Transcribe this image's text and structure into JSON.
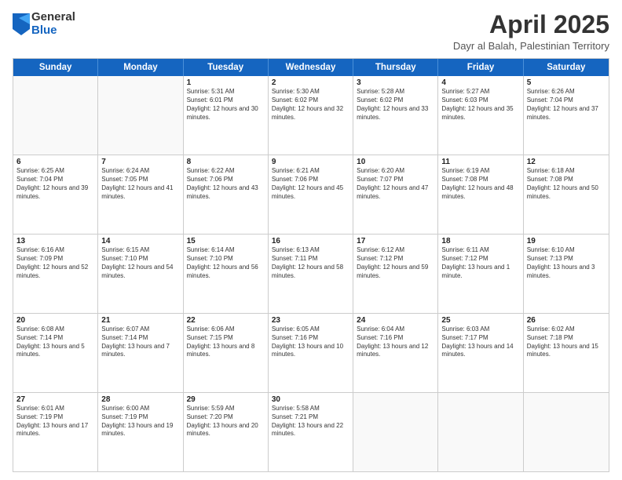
{
  "logo": {
    "general": "General",
    "blue": "Blue"
  },
  "title": {
    "month": "April 2025",
    "location": "Dayr al Balah, Palestinian Territory"
  },
  "header_days": [
    "Sunday",
    "Monday",
    "Tuesday",
    "Wednesday",
    "Thursday",
    "Friday",
    "Saturday"
  ],
  "weeks": [
    [
      {
        "day": "",
        "sunrise": "",
        "sunset": "",
        "daylight": "",
        "empty": true
      },
      {
        "day": "",
        "sunrise": "",
        "sunset": "",
        "daylight": "",
        "empty": true
      },
      {
        "day": "1",
        "sunrise": "Sunrise: 5:31 AM",
        "sunset": "Sunset: 6:01 PM",
        "daylight": "Daylight: 12 hours and 30 minutes."
      },
      {
        "day": "2",
        "sunrise": "Sunrise: 5:30 AM",
        "sunset": "Sunset: 6:02 PM",
        "daylight": "Daylight: 12 hours and 32 minutes."
      },
      {
        "day": "3",
        "sunrise": "Sunrise: 5:28 AM",
        "sunset": "Sunset: 6:02 PM",
        "daylight": "Daylight: 12 hours and 33 minutes."
      },
      {
        "day": "4",
        "sunrise": "Sunrise: 5:27 AM",
        "sunset": "Sunset: 6:03 PM",
        "daylight": "Daylight: 12 hours and 35 minutes."
      },
      {
        "day": "5",
        "sunrise": "Sunrise: 6:26 AM",
        "sunset": "Sunset: 7:04 PM",
        "daylight": "Daylight: 12 hours and 37 minutes."
      }
    ],
    [
      {
        "day": "6",
        "sunrise": "Sunrise: 6:25 AM",
        "sunset": "Sunset: 7:04 PM",
        "daylight": "Daylight: 12 hours and 39 minutes."
      },
      {
        "day": "7",
        "sunrise": "Sunrise: 6:24 AM",
        "sunset": "Sunset: 7:05 PM",
        "daylight": "Daylight: 12 hours and 41 minutes."
      },
      {
        "day": "8",
        "sunrise": "Sunrise: 6:22 AM",
        "sunset": "Sunset: 7:06 PM",
        "daylight": "Daylight: 12 hours and 43 minutes."
      },
      {
        "day": "9",
        "sunrise": "Sunrise: 6:21 AM",
        "sunset": "Sunset: 7:06 PM",
        "daylight": "Daylight: 12 hours and 45 minutes."
      },
      {
        "day": "10",
        "sunrise": "Sunrise: 6:20 AM",
        "sunset": "Sunset: 7:07 PM",
        "daylight": "Daylight: 12 hours and 47 minutes."
      },
      {
        "day": "11",
        "sunrise": "Sunrise: 6:19 AM",
        "sunset": "Sunset: 7:08 PM",
        "daylight": "Daylight: 12 hours and 48 minutes."
      },
      {
        "day": "12",
        "sunrise": "Sunrise: 6:18 AM",
        "sunset": "Sunset: 7:08 PM",
        "daylight": "Daylight: 12 hours and 50 minutes."
      }
    ],
    [
      {
        "day": "13",
        "sunrise": "Sunrise: 6:16 AM",
        "sunset": "Sunset: 7:09 PM",
        "daylight": "Daylight: 12 hours and 52 minutes."
      },
      {
        "day": "14",
        "sunrise": "Sunrise: 6:15 AM",
        "sunset": "Sunset: 7:10 PM",
        "daylight": "Daylight: 12 hours and 54 minutes."
      },
      {
        "day": "15",
        "sunrise": "Sunrise: 6:14 AM",
        "sunset": "Sunset: 7:10 PM",
        "daylight": "Daylight: 12 hours and 56 minutes."
      },
      {
        "day": "16",
        "sunrise": "Sunrise: 6:13 AM",
        "sunset": "Sunset: 7:11 PM",
        "daylight": "Daylight: 12 hours and 58 minutes."
      },
      {
        "day": "17",
        "sunrise": "Sunrise: 6:12 AM",
        "sunset": "Sunset: 7:12 PM",
        "daylight": "Daylight: 12 hours and 59 minutes."
      },
      {
        "day": "18",
        "sunrise": "Sunrise: 6:11 AM",
        "sunset": "Sunset: 7:12 PM",
        "daylight": "Daylight: 13 hours and 1 minute."
      },
      {
        "day": "19",
        "sunrise": "Sunrise: 6:10 AM",
        "sunset": "Sunset: 7:13 PM",
        "daylight": "Daylight: 13 hours and 3 minutes."
      }
    ],
    [
      {
        "day": "20",
        "sunrise": "Sunrise: 6:08 AM",
        "sunset": "Sunset: 7:14 PM",
        "daylight": "Daylight: 13 hours and 5 minutes."
      },
      {
        "day": "21",
        "sunrise": "Sunrise: 6:07 AM",
        "sunset": "Sunset: 7:14 PM",
        "daylight": "Daylight: 13 hours and 7 minutes."
      },
      {
        "day": "22",
        "sunrise": "Sunrise: 6:06 AM",
        "sunset": "Sunset: 7:15 PM",
        "daylight": "Daylight: 13 hours and 8 minutes."
      },
      {
        "day": "23",
        "sunrise": "Sunrise: 6:05 AM",
        "sunset": "Sunset: 7:16 PM",
        "daylight": "Daylight: 13 hours and 10 minutes."
      },
      {
        "day": "24",
        "sunrise": "Sunrise: 6:04 AM",
        "sunset": "Sunset: 7:16 PM",
        "daylight": "Daylight: 13 hours and 12 minutes."
      },
      {
        "day": "25",
        "sunrise": "Sunrise: 6:03 AM",
        "sunset": "Sunset: 7:17 PM",
        "daylight": "Daylight: 13 hours and 14 minutes."
      },
      {
        "day": "26",
        "sunrise": "Sunrise: 6:02 AM",
        "sunset": "Sunset: 7:18 PM",
        "daylight": "Daylight: 13 hours and 15 minutes."
      }
    ],
    [
      {
        "day": "27",
        "sunrise": "Sunrise: 6:01 AM",
        "sunset": "Sunset: 7:19 PM",
        "daylight": "Daylight: 13 hours and 17 minutes."
      },
      {
        "day": "28",
        "sunrise": "Sunrise: 6:00 AM",
        "sunset": "Sunset: 7:19 PM",
        "daylight": "Daylight: 13 hours and 19 minutes."
      },
      {
        "day": "29",
        "sunrise": "Sunrise: 5:59 AM",
        "sunset": "Sunset: 7:20 PM",
        "daylight": "Daylight: 13 hours and 20 minutes."
      },
      {
        "day": "30",
        "sunrise": "Sunrise: 5:58 AM",
        "sunset": "Sunset: 7:21 PM",
        "daylight": "Daylight: 13 hours and 22 minutes."
      },
      {
        "day": "",
        "sunrise": "",
        "sunset": "",
        "daylight": "",
        "empty": true
      },
      {
        "day": "",
        "sunrise": "",
        "sunset": "",
        "daylight": "",
        "empty": true
      },
      {
        "day": "",
        "sunrise": "",
        "sunset": "",
        "daylight": "",
        "empty": true
      }
    ]
  ]
}
